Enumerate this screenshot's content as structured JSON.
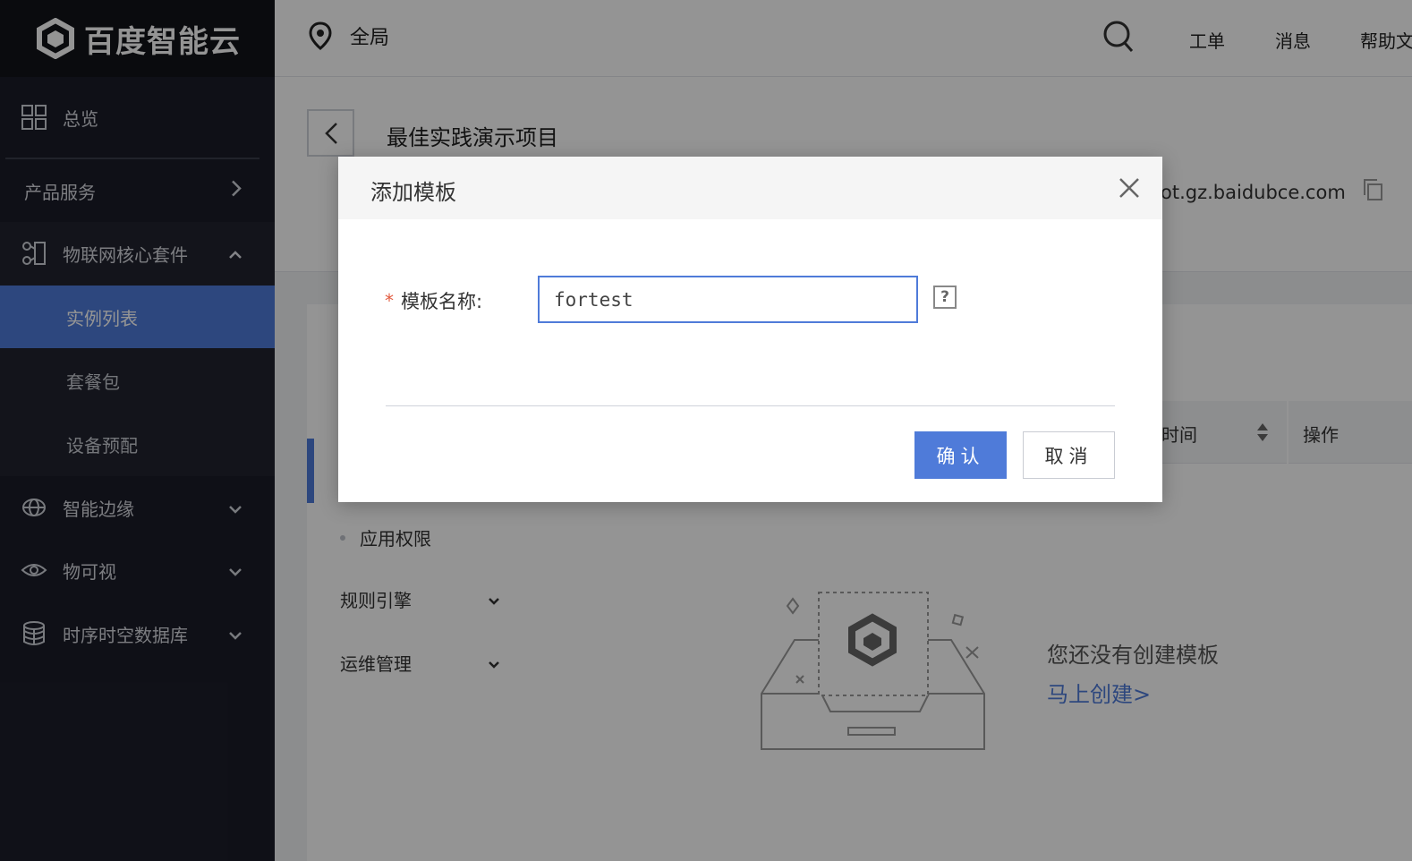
{
  "brand": {
    "name": "百度智能云",
    "icon": "baidu-cloud-hexagon-logo"
  },
  "sidebar": {
    "overview": {
      "label": "总览",
      "icon": "grid-icon"
    },
    "products": {
      "label": "产品服务",
      "icon": "chevron-right-icon"
    },
    "iot_core": {
      "label": "物联网核心套件",
      "icon": "nodes-icon"
    },
    "iot_sub": [
      {
        "label": "实例列表",
        "active": true
      },
      {
        "label": "套餐包",
        "active": false
      },
      {
        "label": "设备预配",
        "active": false
      }
    ],
    "groups": [
      {
        "label": "智能边缘",
        "icon": "edge-icon"
      },
      {
        "label": "物可视",
        "icon": "eye-icon"
      },
      {
        "label": "时序时空数据库",
        "icon": "database-icon"
      }
    ]
  },
  "topbar": {
    "region": "全局",
    "links": [
      "工单",
      "消息",
      "帮助文"
    ]
  },
  "page": {
    "project_title": "最佳实践演示项目",
    "endpoint_text": "ot.gz.baidubce.com"
  },
  "subnav": {
    "items": [
      {
        "label": "应用权限",
        "type": "leaf"
      },
      {
        "label": "规则引擎",
        "type": "group"
      },
      {
        "label": "运维管理",
        "type": "group"
      }
    ]
  },
  "table": {
    "col_time": "时间",
    "col_op": "操作"
  },
  "empty_state": {
    "text": "您还没有创建模板",
    "link": "马上创建>"
  },
  "modal": {
    "title": "添加模板",
    "field_label": "模板名称:",
    "required_mark": "*",
    "field_value": "fortest",
    "help": "?",
    "confirm_label": "确认",
    "cancel_label": "取消"
  },
  "colors": {
    "accent": "#4f7bd9",
    "sidebar_bg": "#1b1d29",
    "required": "#e25b3f"
  }
}
